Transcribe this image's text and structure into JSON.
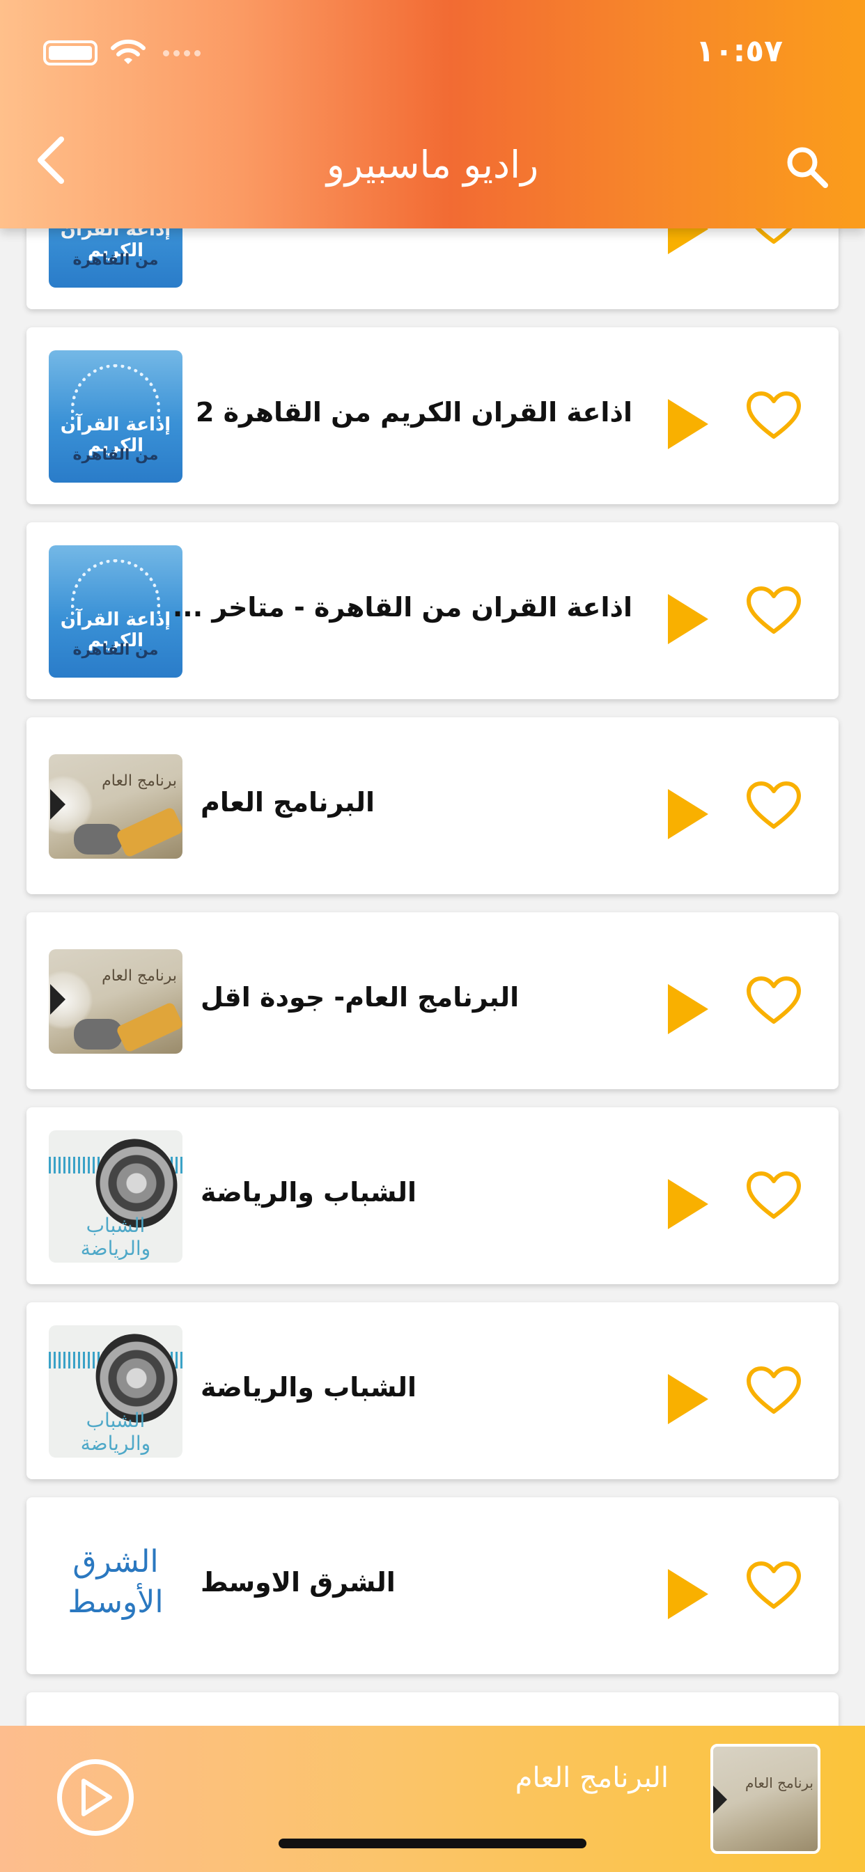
{
  "status_bar": {
    "time": "١٠:٥٧"
  },
  "header": {
    "title": "راديو ماسبيرو"
  },
  "thumb_labels": {
    "quran_line1": "إذاعة القرآن الكريم",
    "quran_line2": "من القاهرة",
    "general": "برنامج العام",
    "sports": "الشباب والرياضة",
    "sharq_line1": "الشرق",
    "sharq_line2": "الأوسط"
  },
  "stations": [
    {
      "name": "",
      "thumb": "quran"
    },
    {
      "name": "اذاعة القران الكريم من القاهرة 2",
      "thumb": "quran"
    },
    {
      "name": "اذاعة القران من القاهرة - متاخر ...",
      "thumb": "quran"
    },
    {
      "name": "البرنامج العام",
      "thumb": "general"
    },
    {
      "name": "البرنامج العام- جودة اقل",
      "thumb": "general"
    },
    {
      "name": "الشباب والرياضة",
      "thumb": "sports"
    },
    {
      "name": "الشباب والرياضة",
      "thumb": "sports"
    },
    {
      "name": "الشرق الاوسط",
      "thumb": "sharq"
    }
  ],
  "player": {
    "title": "البرنامج العام"
  },
  "colors": {
    "accent": "#f9b000",
    "header_start": "#ffc08b",
    "header_mid": "#f26b33",
    "header_end": "#fb9d1b"
  },
  "icons": {
    "back": "chevron-left-icon",
    "search": "search-icon",
    "play": "play-icon",
    "favorite": "heart-outline-icon"
  }
}
